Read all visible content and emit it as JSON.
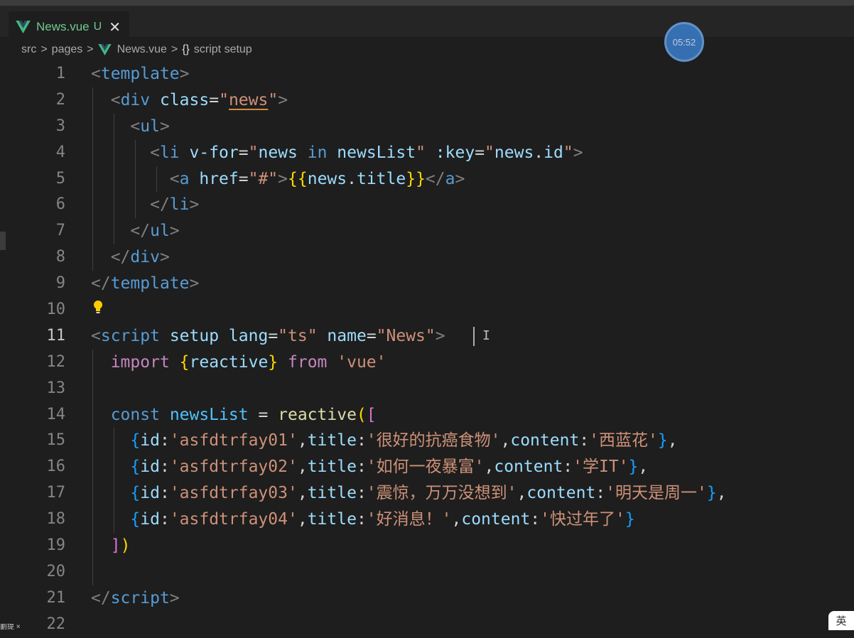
{
  "tab": {
    "filename": "News.vue",
    "status": "U",
    "close_glyph": "✕"
  },
  "breadcrumb": {
    "parts": [
      "src",
      "pages",
      "News.vue",
      "script setup"
    ],
    "separator": ">",
    "braces": "{}"
  },
  "timer": {
    "label": "05:52"
  },
  "ime": {
    "label": "英"
  },
  "bottom_fragment": "劃提 ×",
  "icons": [
    "vue-logo-icon",
    "close-icon",
    "lightbulb-icon",
    "text-cursor-icon"
  ],
  "colors": {
    "keyword": "#c586c0",
    "tag": "#569cd6",
    "string": "#ce9178",
    "attribute": "#9cdcfe",
    "function": "#dcdcaa"
  },
  "editor": {
    "active_line": 11,
    "lines": [
      {
        "n": "1",
        "tokens": [
          [
            "t-tag",
            "<"
          ],
          [
            "t-name",
            "template"
          ],
          [
            "t-tag",
            ">"
          ]
        ]
      },
      {
        "n": "2",
        "tokens": [
          [
            "t-plain",
            "  "
          ],
          [
            "t-tag",
            "<"
          ],
          [
            "t-name",
            "div"
          ],
          [
            "t-plain",
            " "
          ],
          [
            "t-attr",
            "class"
          ],
          [
            "t-plain",
            "="
          ],
          [
            "t-str",
            "\""
          ],
          [
            "t-str-u",
            "news"
          ],
          [
            "t-str",
            "\""
          ],
          [
            "t-tag",
            ">"
          ]
        ]
      },
      {
        "n": "3",
        "tokens": [
          [
            "t-plain",
            "    "
          ],
          [
            "t-tag",
            "<"
          ],
          [
            "t-name",
            "ul"
          ],
          [
            "t-tag",
            ">"
          ]
        ]
      },
      {
        "n": "4",
        "tokens": [
          [
            "t-plain",
            "      "
          ],
          [
            "t-tag",
            "<"
          ],
          [
            "t-name",
            "li"
          ],
          [
            "t-plain",
            " "
          ],
          [
            "t-attr",
            "v-for"
          ],
          [
            "t-plain",
            "="
          ],
          [
            "t-str",
            "\""
          ],
          [
            "t-var",
            "news"
          ],
          [
            "t-plain",
            " "
          ],
          [
            "t-name",
            "in"
          ],
          [
            "t-plain",
            " "
          ],
          [
            "t-var",
            "newsList"
          ],
          [
            "t-str",
            "\""
          ],
          [
            "t-plain",
            " "
          ],
          [
            "t-attr",
            ":key"
          ],
          [
            "t-plain",
            "="
          ],
          [
            "t-str",
            "\""
          ],
          [
            "t-var",
            "news"
          ],
          [
            "t-plain",
            "."
          ],
          [
            "t-var",
            "id"
          ],
          [
            "t-str",
            "\""
          ],
          [
            "t-tag",
            ">"
          ]
        ]
      },
      {
        "n": "5",
        "tokens": [
          [
            "t-plain",
            "        "
          ],
          [
            "t-tag",
            "<"
          ],
          [
            "t-name",
            "a"
          ],
          [
            "t-plain",
            " "
          ],
          [
            "t-attr",
            "href"
          ],
          [
            "t-plain",
            "="
          ],
          [
            "t-str",
            "\"#\""
          ],
          [
            "t-tag",
            ">"
          ],
          [
            "t-brace",
            "{{"
          ],
          [
            "t-var",
            "news"
          ],
          [
            "t-plain",
            "."
          ],
          [
            "t-var",
            "title"
          ],
          [
            "t-brace",
            "}}"
          ],
          [
            "t-tag",
            "</"
          ],
          [
            "t-name",
            "a"
          ],
          [
            "t-tag",
            ">"
          ]
        ]
      },
      {
        "n": "6",
        "tokens": [
          [
            "t-plain",
            "      "
          ],
          [
            "t-tag",
            "</"
          ],
          [
            "t-name",
            "li"
          ],
          [
            "t-tag",
            ">"
          ]
        ]
      },
      {
        "n": "7",
        "tokens": [
          [
            "t-plain",
            "    "
          ],
          [
            "t-tag",
            "</"
          ],
          [
            "t-name",
            "ul"
          ],
          [
            "t-tag",
            ">"
          ]
        ]
      },
      {
        "n": "8",
        "tokens": [
          [
            "t-plain",
            "  "
          ],
          [
            "t-tag",
            "</"
          ],
          [
            "t-name",
            "div"
          ],
          [
            "t-tag",
            ">"
          ]
        ]
      },
      {
        "n": "9",
        "tokens": [
          [
            "t-tag",
            "</"
          ],
          [
            "t-name",
            "template"
          ],
          [
            "t-tag",
            ">"
          ]
        ]
      },
      {
        "n": "10",
        "tokens": []
      },
      {
        "n": "11",
        "tokens": [
          [
            "t-tag",
            "<"
          ],
          [
            "t-name",
            "script"
          ],
          [
            "t-plain",
            " "
          ],
          [
            "t-attr",
            "setup"
          ],
          [
            "t-plain",
            " "
          ],
          [
            "t-attr",
            "lang"
          ],
          [
            "t-plain",
            "="
          ],
          [
            "t-str",
            "\"ts\""
          ],
          [
            "t-plain",
            " "
          ],
          [
            "t-attr",
            "name"
          ],
          [
            "t-plain",
            "="
          ],
          [
            "t-str",
            "\"News\""
          ],
          [
            "t-tag",
            ">"
          ]
        ]
      },
      {
        "n": "12",
        "tokens": [
          [
            "t-plain",
            "  "
          ],
          [
            "t-kw",
            "import"
          ],
          [
            "t-plain",
            " "
          ],
          [
            "t-brace",
            "{"
          ],
          [
            "t-var",
            "reactive"
          ],
          [
            "t-brace",
            "}"
          ],
          [
            "t-plain",
            " "
          ],
          [
            "t-kw",
            "from"
          ],
          [
            "t-plain",
            " "
          ],
          [
            "t-str",
            "'vue'"
          ]
        ]
      },
      {
        "n": "13",
        "tokens": []
      },
      {
        "n": "14",
        "tokens": [
          [
            "t-plain",
            "  "
          ],
          [
            "t-name",
            "const"
          ],
          [
            "t-plain",
            " "
          ],
          [
            "t-cn",
            "newsList"
          ],
          [
            "t-plain",
            " = "
          ],
          [
            "t-fn",
            "reactive"
          ],
          [
            "t-brace",
            "("
          ],
          [
            "t-brace2",
            "["
          ]
        ]
      },
      {
        "n": "15",
        "tokens": [
          [
            "t-plain",
            "    "
          ],
          [
            "t-brace3",
            "{"
          ],
          [
            "t-var",
            "id"
          ],
          [
            "t-plain",
            ":"
          ],
          [
            "t-str",
            "'asfdtrfay01'"
          ],
          [
            "t-plain",
            ","
          ],
          [
            "t-var",
            "title"
          ],
          [
            "t-plain",
            ":"
          ],
          [
            "t-str",
            "'很好的抗癌食物'"
          ],
          [
            "t-plain",
            ","
          ],
          [
            "t-var",
            "content"
          ],
          [
            "t-plain",
            ":"
          ],
          [
            "t-str",
            "'西蓝花'"
          ],
          [
            "t-brace3",
            "}"
          ],
          [
            "t-plain",
            ","
          ]
        ]
      },
      {
        "n": "16",
        "tokens": [
          [
            "t-plain",
            "    "
          ],
          [
            "t-brace3",
            "{"
          ],
          [
            "t-var",
            "id"
          ],
          [
            "t-plain",
            ":"
          ],
          [
            "t-str",
            "'asfdtrfay02'"
          ],
          [
            "t-plain",
            ","
          ],
          [
            "t-var",
            "title"
          ],
          [
            "t-plain",
            ":"
          ],
          [
            "t-str",
            "'如何一夜暴富'"
          ],
          [
            "t-plain",
            ","
          ],
          [
            "t-var",
            "content"
          ],
          [
            "t-plain",
            ":"
          ],
          [
            "t-str",
            "'学IT'"
          ],
          [
            "t-brace3",
            "}"
          ],
          [
            "t-plain",
            ","
          ]
        ]
      },
      {
        "n": "17",
        "tokens": [
          [
            "t-plain",
            "    "
          ],
          [
            "t-brace3",
            "{"
          ],
          [
            "t-var",
            "id"
          ],
          [
            "t-plain",
            ":"
          ],
          [
            "t-str",
            "'asfdtrfay03'"
          ],
          [
            "t-plain",
            ","
          ],
          [
            "t-var",
            "title"
          ],
          [
            "t-plain",
            ":"
          ],
          [
            "t-str",
            "'震惊，万万没想到'"
          ],
          [
            "t-plain",
            ","
          ],
          [
            "t-var",
            "content"
          ],
          [
            "t-plain",
            ":"
          ],
          [
            "t-str",
            "'明天是周一'"
          ],
          [
            "t-brace3",
            "}"
          ],
          [
            "t-plain",
            ","
          ]
        ]
      },
      {
        "n": "18",
        "tokens": [
          [
            "t-plain",
            "    "
          ],
          [
            "t-brace3",
            "{"
          ],
          [
            "t-var",
            "id"
          ],
          [
            "t-plain",
            ":"
          ],
          [
            "t-str",
            "'asfdtrfay04'"
          ],
          [
            "t-plain",
            ","
          ],
          [
            "t-var",
            "title"
          ],
          [
            "t-plain",
            ":"
          ],
          [
            "t-str",
            "'好消息！'"
          ],
          [
            "t-plain",
            ","
          ],
          [
            "t-var",
            "content"
          ],
          [
            "t-plain",
            ":"
          ],
          [
            "t-str",
            "'快过年了'"
          ],
          [
            "t-brace3",
            "}"
          ]
        ]
      },
      {
        "n": "19",
        "tokens": [
          [
            "t-plain",
            "  "
          ],
          [
            "t-brace2",
            "]"
          ],
          [
            "t-brace",
            ")"
          ]
        ]
      },
      {
        "n": "20",
        "tokens": []
      },
      {
        "n": "21",
        "tokens": [
          [
            "t-tag",
            "</"
          ],
          [
            "t-name",
            "script"
          ],
          [
            "t-tag",
            ">"
          ]
        ]
      },
      {
        "n": "22",
        "tokens": []
      }
    ]
  }
}
